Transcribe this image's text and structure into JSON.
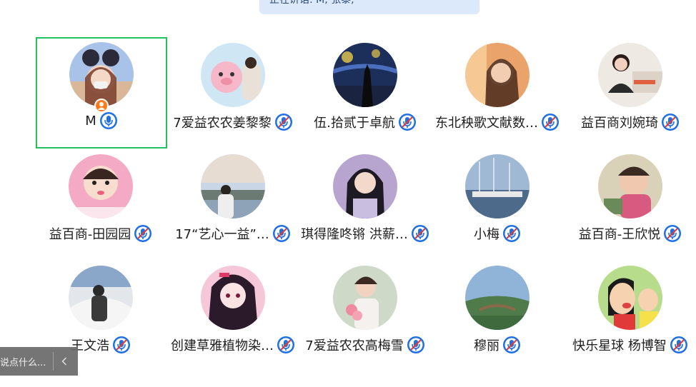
{
  "banner": {
    "speaking_text": "正在讲话: M, 张黎,"
  },
  "participants": [
    {
      "name": "M",
      "host": true,
      "active": true,
      "mic": "on"
    },
    {
      "name": "7爱益农农姜黎黎",
      "mic": "muted"
    },
    {
      "name": "伍.拾贰于卓航",
      "mic": "muted"
    },
    {
      "name": "东北秧歌文献数…",
      "mic": "muted"
    },
    {
      "name": "益百商刘婉琦",
      "mic": "muted"
    },
    {
      "name": "益百商-田园园",
      "mic": "muted"
    },
    {
      "name": "17“艺心一益”…",
      "mic": "muted"
    },
    {
      "name": "琪得隆咚锵  洪薪…",
      "mic": "muted"
    },
    {
      "name": "小梅",
      "mic": "muted"
    },
    {
      "name": "益百商-王欣悦",
      "mic": "muted"
    },
    {
      "name": "王文浩",
      "mic": "muted"
    },
    {
      "name": "创建草雅植物染…",
      "mic": "muted"
    },
    {
      "name": "7爱益农农高梅雪",
      "mic": "muted"
    },
    {
      "name": "穆丽",
      "mic": "muted"
    },
    {
      "name": "快乐星球 杨博智",
      "mic": "muted"
    }
  ],
  "chat": {
    "placeholder": "说点什么..."
  },
  "colors": {
    "active_border": "#22c35e",
    "mic_blue": "#1f6fe5",
    "host_badge": "#ff7a1a",
    "banner_bg": "#dce9fb"
  },
  "icons": {
    "mic_on": "microphone-icon",
    "mic_muted": "microphone-muted-icon",
    "host": "host-person-icon",
    "collapse": "chevron-left-icon"
  }
}
